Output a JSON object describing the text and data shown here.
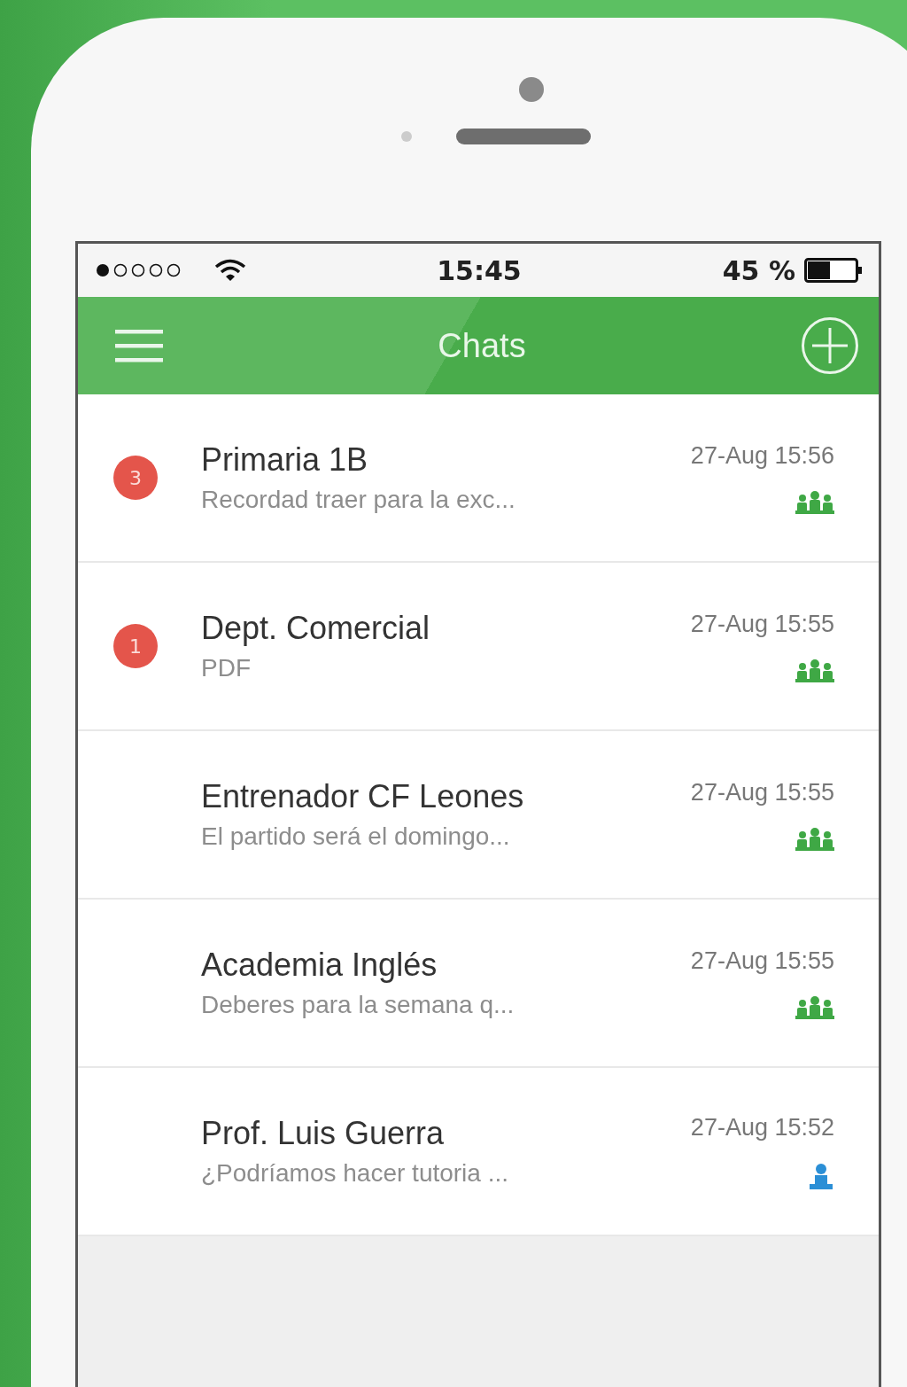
{
  "status_bar": {
    "time": "15:45",
    "battery": "45 %"
  },
  "header": {
    "title": "Chats"
  },
  "chats": [
    {
      "name": "Primaria 1B",
      "preview": "Recordad traer para la exc...",
      "time": "27-Aug 15:56",
      "unread": "3",
      "kind": "group"
    },
    {
      "name": "Dept. Comercial",
      "preview": "PDF",
      "time": "27-Aug 15:55",
      "unread": "1",
      "kind": "group"
    },
    {
      "name": "Entrenador CF Leones",
      "preview": "El partido será el domingo...",
      "time": "27-Aug 15:55",
      "kind": "group"
    },
    {
      "name": "Academia Inglés",
      "preview": "Deberes para la semana q...",
      "time": "27-Aug 15:55",
      "kind": "group"
    },
    {
      "name": "Prof. Luis Guerra",
      "preview": "¿Podríamos hacer tutoria ...",
      "time": "27-Aug 15:52",
      "kind": "person"
    }
  ]
}
